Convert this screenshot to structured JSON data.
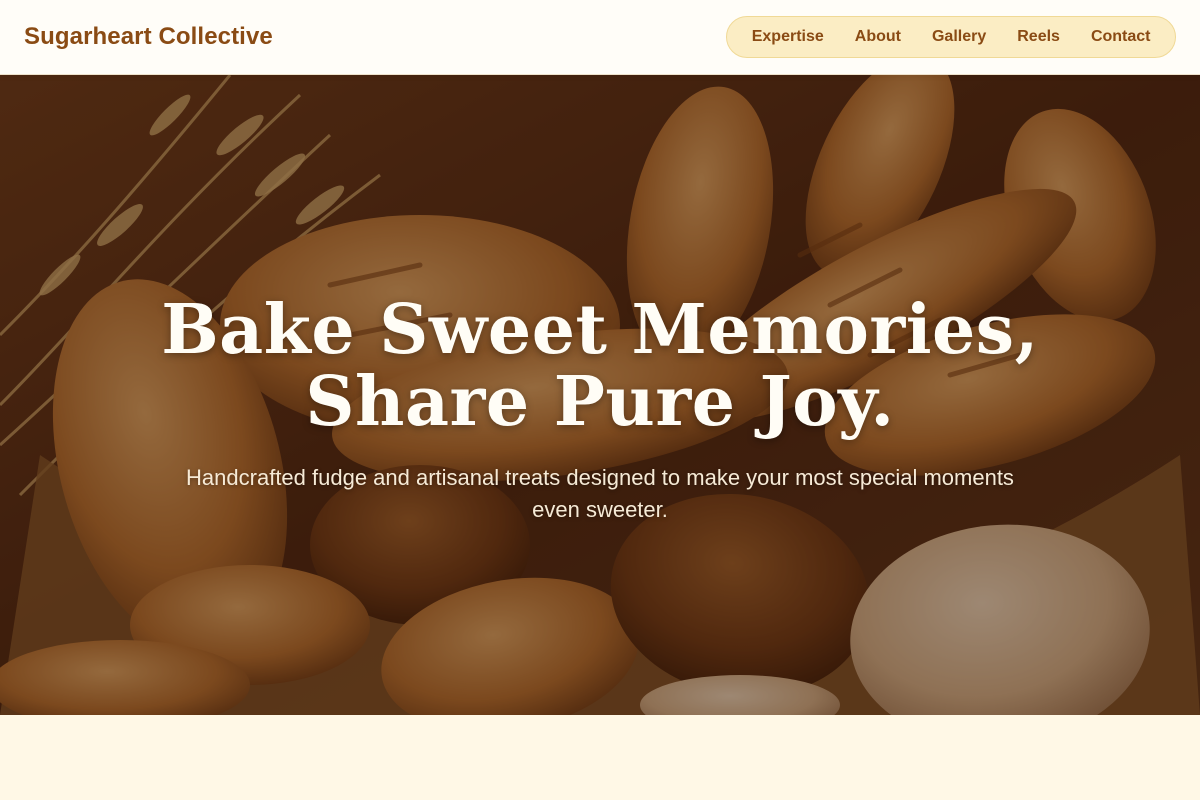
{
  "brand": {
    "name": "Sugarheart Collective"
  },
  "nav": {
    "items": [
      {
        "label": "Expertise"
      },
      {
        "label": "About"
      },
      {
        "label": "Gallery"
      },
      {
        "label": "Reels"
      },
      {
        "label": "Contact"
      }
    ]
  },
  "hero": {
    "headline_line1": "Bake Sweet Memories,",
    "headline_line2": "Share Pure Joy.",
    "subtext": "Handcrafted fudge and artisanal treats designed to make your most special moments even sweeter."
  },
  "colors": {
    "brand_brown": "#8a4b14",
    "nav_pill_bg": "#fbedc4",
    "page_bg": "#fff8e6"
  }
}
